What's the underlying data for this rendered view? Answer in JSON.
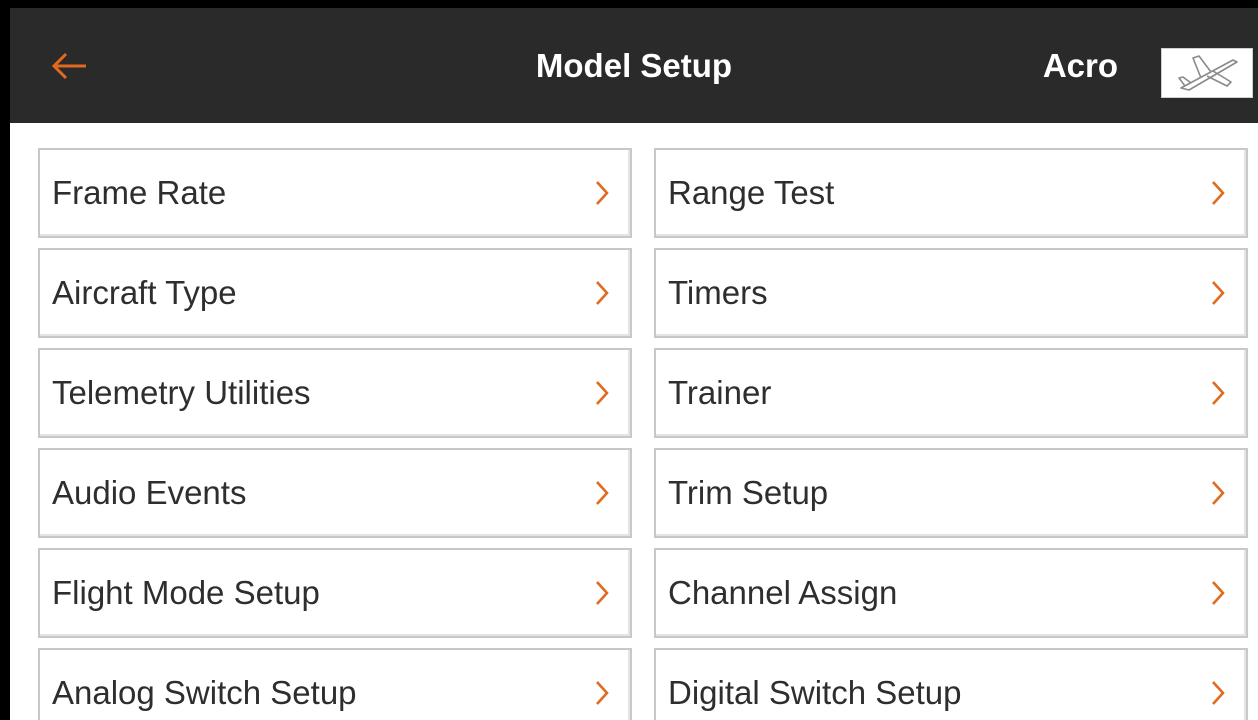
{
  "header": {
    "title": "Model Setup",
    "model_name": "Acro",
    "back_icon": "arrow-left-icon",
    "model_type_icon": "airplane-icon"
  },
  "colors": {
    "accent": "#e06a1f",
    "header_bg": "#2a2a2a",
    "text": "#2e2e2e"
  },
  "menu": {
    "left": [
      {
        "label": "Frame Rate"
      },
      {
        "label": "Aircraft Type"
      },
      {
        "label": "Telemetry Utilities"
      },
      {
        "label": "Audio Events"
      },
      {
        "label": "Flight Mode Setup"
      },
      {
        "label": "Analog Switch Setup"
      }
    ],
    "right": [
      {
        "label": "Range Test"
      },
      {
        "label": "Timers"
      },
      {
        "label": "Trainer"
      },
      {
        "label": "Trim Setup"
      },
      {
        "label": "Channel Assign"
      },
      {
        "label": "Digital Switch Setup"
      }
    ]
  }
}
